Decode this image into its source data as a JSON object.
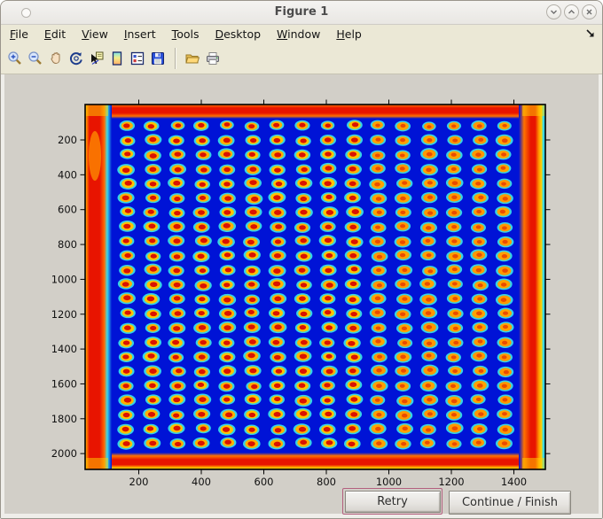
{
  "window": {
    "title": "Figure 1",
    "controls": {
      "minimize": "chevron-down",
      "maximize": "chevron-up",
      "close": "x"
    }
  },
  "menubar": {
    "items": [
      {
        "label": "File"
      },
      {
        "label": "Edit"
      },
      {
        "label": "View"
      },
      {
        "label": "Insert"
      },
      {
        "label": "Tools"
      },
      {
        "label": "Desktop"
      },
      {
        "label": "Window"
      },
      {
        "label": "Help"
      }
    ]
  },
  "toolbar": {
    "buttons": [
      "zoom-in",
      "zoom-out",
      "pan",
      "rotate-3d",
      "data-cursor",
      "insert-colorbar",
      "insert-legend",
      "save-figure",
      "open-file",
      "print-figure"
    ]
  },
  "figure": {
    "axes": {
      "x_ticks": [
        200,
        400,
        600,
        800,
        1000,
        1200,
        1400
      ],
      "y_ticks": [
        200,
        400,
        600,
        800,
        1000,
        1200,
        1400,
        1600,
        1800,
        2000
      ]
    },
    "image": {
      "type": "heatmap-image",
      "colormap": "jet",
      "description": "scanned spot-array plate: grid of hot spots on blue field with hot edges",
      "grid": {
        "cols": 16,
        "rows": 23
      },
      "colors": {
        "background": "#0013d6",
        "halo": "#38dde8",
        "ring": "#ffc300",
        "ring_right": "#ffa200",
        "core": "#da1200",
        "core_right": "#e84400",
        "edge_red": "#e81400",
        "edge_orange": "#ff7300",
        "edge_yellow": "#ffd300",
        "edge_cyan": "#30c4e8",
        "edge_dark": "#8a0e00"
      }
    }
  },
  "actions": {
    "retry": "Retry",
    "continue_finish": "Continue / Finish"
  }
}
